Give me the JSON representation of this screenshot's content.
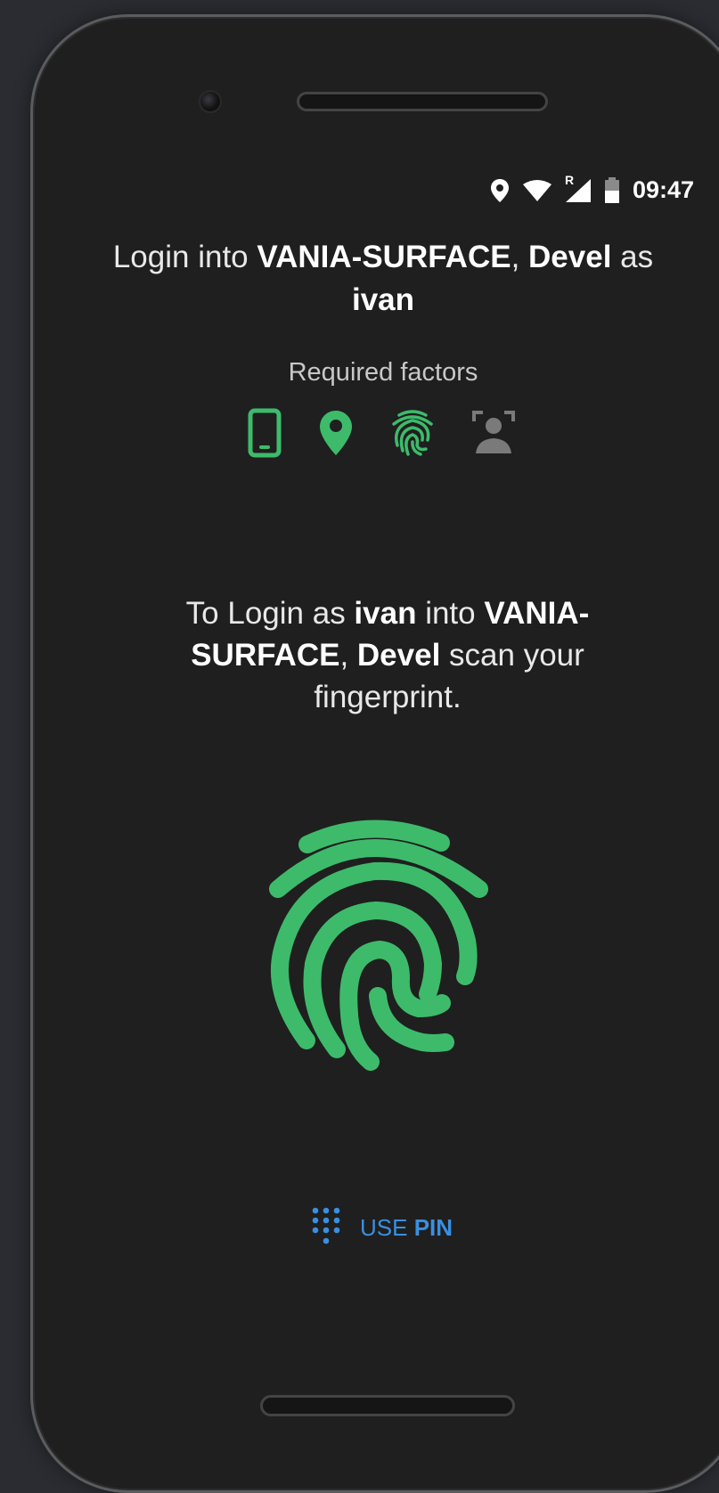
{
  "status_bar": {
    "time": "09:47",
    "icons": [
      "location-icon",
      "wifi-icon",
      "cellular-roaming-icon",
      "battery-icon"
    ],
    "roaming_marker": "R"
  },
  "title": {
    "prefix": "Login into ",
    "machine": "VANIA-SURFACE",
    "comma": ", ",
    "domain": "Devel",
    "as": " as",
    "user": "ivan"
  },
  "required_factors": {
    "label": "Required factors",
    "factors": [
      {
        "icon": "phone-icon",
        "state": "active"
      },
      {
        "icon": "location-pin-icon",
        "state": "active"
      },
      {
        "icon": "fingerprint-icon",
        "state": "active"
      },
      {
        "icon": "face-scan-icon",
        "state": "inactive"
      }
    ]
  },
  "message": {
    "p1": "To Login as ",
    "user": "ivan",
    "p2": " into ",
    "machine": "VANIA-SURFACE",
    "p3": ", ",
    "domain": "Devel",
    "p4": " scan your fingerprint."
  },
  "use_pin": {
    "icon": "dialpad-icon",
    "word1": "USE",
    "word2": "PIN"
  },
  "colors": {
    "accent_green": "#3dbb6b",
    "inactive_gray": "#7a7a7a",
    "link_blue": "#3a8fe0",
    "screen_bg": "#1f1f1f"
  }
}
